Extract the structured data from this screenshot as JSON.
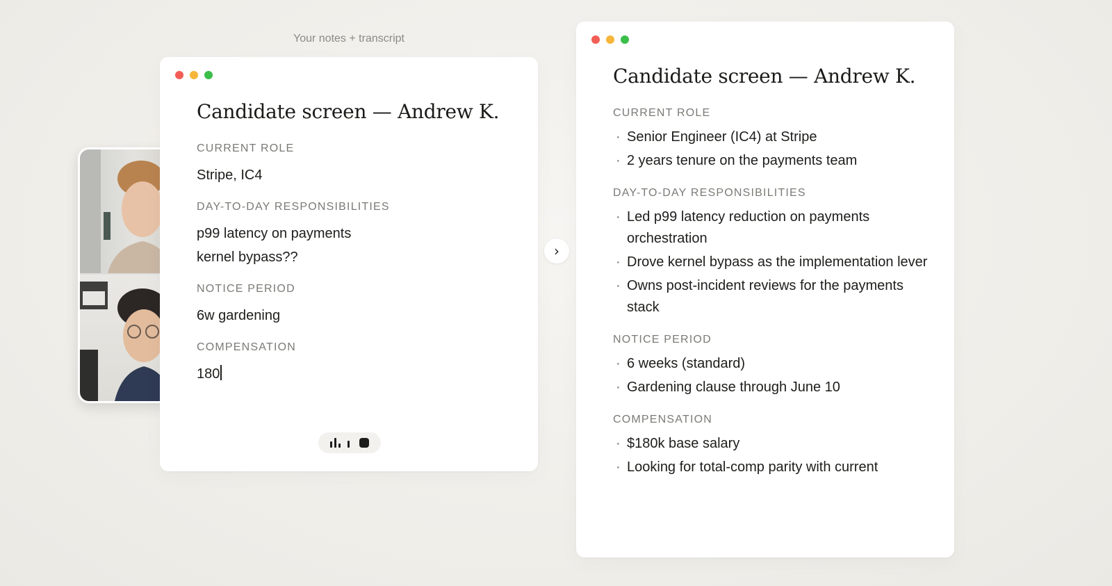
{
  "left_panel": {
    "caption": "Your notes + transcript",
    "title": "Candidate screen — Andrew K.",
    "sections": [
      {
        "label": "CURRENT ROLE",
        "lines": [
          "Stripe, IC4"
        ]
      },
      {
        "label": "DAY-TO-DAY RESPONSIBILITIES",
        "lines": [
          "p99 latency on payments",
          "kernel bypass??"
        ]
      },
      {
        "label": "NOTICE PERIOD",
        "lines": [
          "6w gardening"
        ]
      },
      {
        "label": "COMPENSATION",
        "lines": [
          "180"
        ]
      }
    ]
  },
  "right_panel": {
    "title": "Candidate screen — Andrew K.",
    "sections": [
      {
        "label": "CURRENT ROLE",
        "bullets": [
          "Senior Engineer (IC4) at Stripe",
          "2 years tenure on the payments team"
        ]
      },
      {
        "label": "DAY-TO-DAY RESPONSIBILITIES",
        "bullets": [
          "Led p99 latency reduction on payments orchestration",
          "Drove kernel bypass as the implementation lever",
          "Owns post-incident reviews for the payments stack"
        ]
      },
      {
        "label": "NOTICE PERIOD",
        "bullets": [
          "6 weeks (standard)",
          "Gardening clause through June 10"
        ]
      },
      {
        "label": "COMPENSATION",
        "bullets": [
          "$180k base salary",
          "Looking for total-comp parity with current"
        ]
      }
    ]
  },
  "icons": {
    "bullet": "·",
    "next": "›"
  },
  "colors": {
    "traffic_red": "#f25e55",
    "traffic_yellow": "#f6b63a",
    "traffic_green": "#3cbe4a"
  }
}
